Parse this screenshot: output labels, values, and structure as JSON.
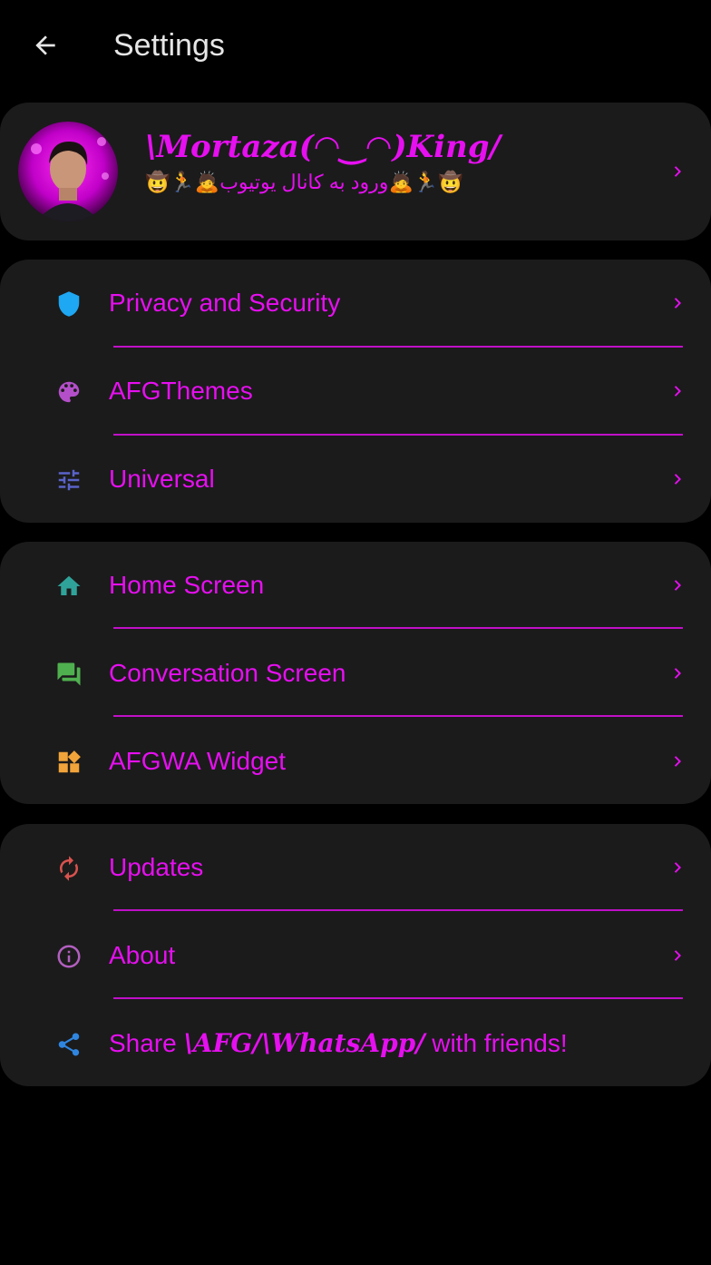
{
  "header": {
    "title": "Settings"
  },
  "profile": {
    "name": "\\Mortaza(◠‿◠)King/",
    "status": "🤠🏃🙇ورود به کانال یوتیوب🙇🏃🤠"
  },
  "groups": [
    {
      "items": [
        {
          "label": "Privacy and Security",
          "icon": "shield-icon",
          "color": "#1ea7f2"
        },
        {
          "label": "AFGThemes",
          "icon": "palette-icon",
          "color": "#b44fc9"
        },
        {
          "label": "Universal",
          "icon": "tune-icon",
          "color": "#5a63c9"
        }
      ]
    },
    {
      "items": [
        {
          "label": "Home Screen",
          "icon": "home-icon",
          "color": "#2fa39a"
        },
        {
          "label": "Conversation Screen",
          "icon": "forum-icon",
          "color": "#4fb04f"
        },
        {
          "label": "AFGWA Widget",
          "icon": "widgets-icon",
          "color": "#f1a43a"
        }
      ]
    },
    {
      "items": [
        {
          "label": "Updates",
          "icon": "refresh-icon",
          "color": "#d9524e"
        },
        {
          "label": "About",
          "icon": "info-icon",
          "color": "#b25fbf"
        },
        {
          "label_prefix": "Share ",
          "label_brand1": "\\AFG/",
          "label_brand2": "\\WhatsApp/",
          "label_suffix": " with friends!",
          "icon": "share-icon",
          "color": "#2f86e0"
        }
      ]
    }
  ],
  "colors": {
    "accent": "#e60ff0",
    "card": "#1b1b1b",
    "background": "#000000",
    "divider": "#c010c8"
  }
}
